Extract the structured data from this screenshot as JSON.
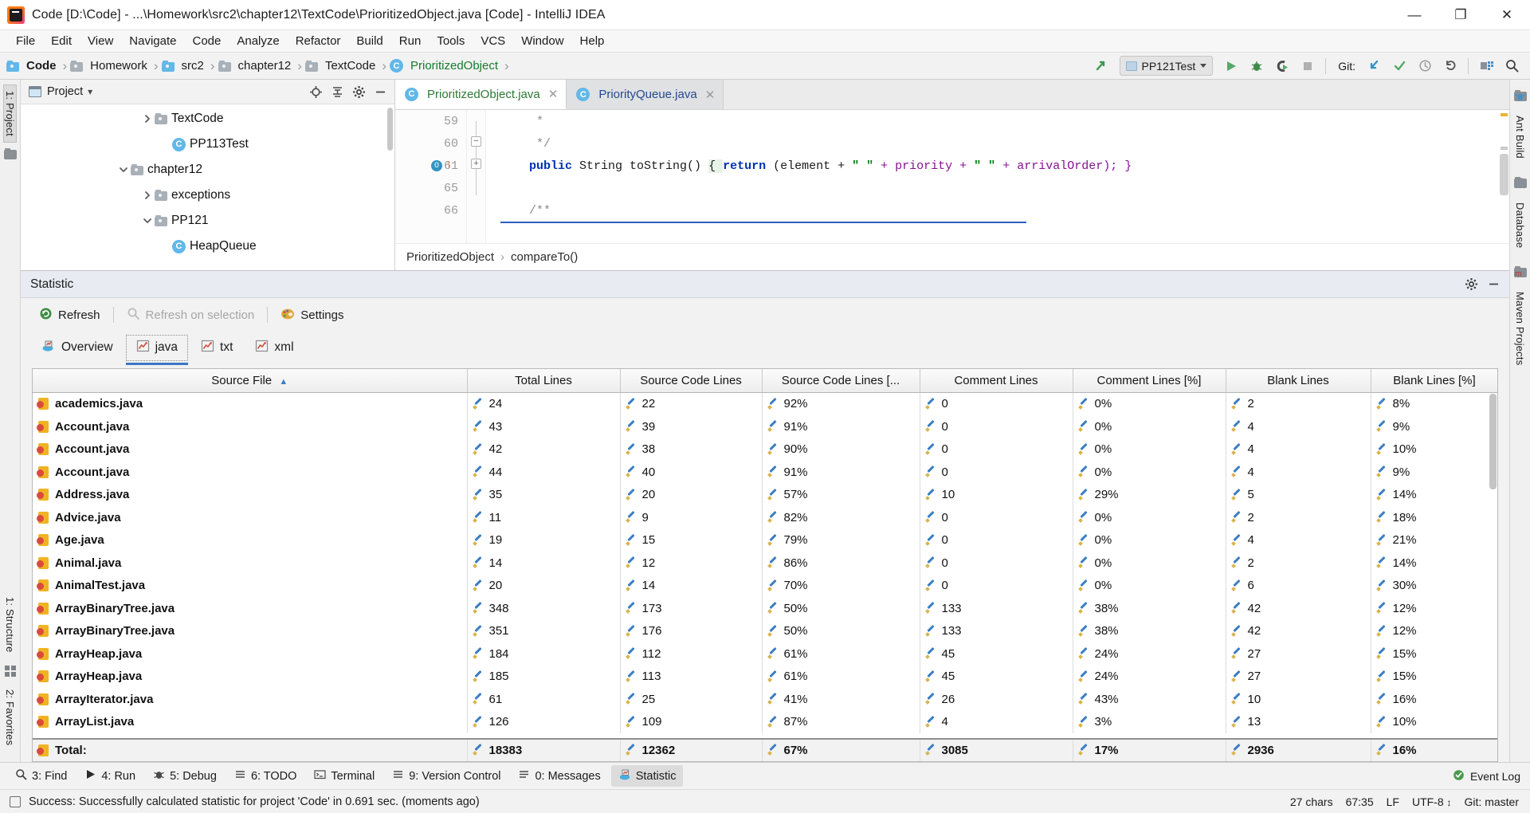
{
  "window": {
    "title": "Code [D:\\Code] - ...\\Homework\\src2\\chapter12\\TextCode\\PrioritizedObject.java [Code] - IntelliJ IDEA",
    "minimize": "—",
    "maximize": "❐",
    "close": "✕"
  },
  "menu": {
    "items": [
      "File",
      "Edit",
      "View",
      "Navigate",
      "Code",
      "Analyze",
      "Refactor",
      "Build",
      "Run",
      "Tools",
      "VCS",
      "Window",
      "Help"
    ]
  },
  "navbar": {
    "crumbs": [
      {
        "label": "Code",
        "icon": "module-folder-icon",
        "bold": true,
        "green": false
      },
      {
        "label": "Homework",
        "icon": "folder-icon",
        "bold": false,
        "green": false
      },
      {
        "label": "src2",
        "icon": "source-folder-icon",
        "bold": false,
        "green": false
      },
      {
        "label": "chapter12",
        "icon": "folder-icon",
        "bold": false,
        "green": false
      },
      {
        "label": "TextCode",
        "icon": "folder-icon",
        "bold": false,
        "green": false
      },
      {
        "label": "PrioritizedObject",
        "icon": "java-class-icon",
        "bold": false,
        "green": true
      }
    ],
    "separator": "›",
    "run_configuration": "PP121Test",
    "git_label": "Git:",
    "buttons": [
      "build-icon",
      "run-button",
      "debug-button",
      "run-coverage-button",
      "stop-button",
      "git-update-button",
      "git-commit-button",
      "git-history-button",
      "git-rollback-button",
      "project-structure-button",
      "search-everywhere-button"
    ]
  },
  "left_rail": {
    "items": [
      "1: Project",
      "1: Structure",
      "2: Favorites"
    ]
  },
  "right_rail": {
    "items": [
      "Ant Build",
      "Database",
      "Maven Projects"
    ]
  },
  "project_panel": {
    "title": "Project",
    "dropdown_caret": "▾",
    "actions": [
      "locate-icon",
      "collapse-all-icon",
      "settings-icon",
      "hide-icon"
    ],
    "tree": [
      {
        "label": "TextCode",
        "depth": 2,
        "icon": "folder-icon",
        "state": "collapsed"
      },
      {
        "label": "PP113Test",
        "depth": 3,
        "icon": "java-class-run-icon",
        "state": "leaf"
      },
      {
        "label": "chapter12",
        "depth": 1,
        "icon": "folder-icon",
        "state": "expanded"
      },
      {
        "label": "exceptions",
        "depth": 2,
        "icon": "folder-icon",
        "state": "collapsed"
      },
      {
        "label": "PP121",
        "depth": 2,
        "icon": "folder-icon",
        "state": "expanded"
      },
      {
        "label": "HeapQueue",
        "depth": 3,
        "icon": "java-class-icon",
        "state": "leaf"
      }
    ]
  },
  "editor": {
    "tabs": [
      {
        "label": "PrioritizedObject.java",
        "active": true,
        "icon": "java-class-icon",
        "close": "✕"
      },
      {
        "label": "PriorityQueue.java",
        "active": false,
        "icon": "java-class-icon",
        "close": "✕"
      }
    ],
    "lines": [
      {
        "number": "59",
        "fold": "",
        "marker": "",
        "segments": [
          {
            "t": "     *",
            "c": "cmt"
          }
        ]
      },
      {
        "number": "60",
        "fold": "minus",
        "marker": "",
        "segments": [
          {
            "t": "     */",
            "c": "cmt"
          }
        ]
      },
      {
        "number": "61",
        "fold": "plus",
        "marker": "override-implement",
        "segments": [
          {
            "t": "    ",
            "c": "ident"
          },
          {
            "t": "public",
            "c": "kw"
          },
          {
            "t": " String toString() ",
            "c": "ident"
          },
          {
            "t": "{ ",
            "c": "ident"
          },
          {
            "t": "return",
            "c": "kw"
          },
          {
            "t": " (element + ",
            "c": "ident"
          },
          {
            "t": "\" \"",
            "c": "str"
          },
          {
            "t": " + priority + ",
            "c": "ident"
          },
          {
            "t": "\" \"",
            "c": "str"
          },
          {
            "t": " + arrivalOrder); }",
            "c": "ident"
          }
        ]
      },
      {
        "number": "65",
        "fold": "",
        "marker": "",
        "segments": [
          {
            "t": "",
            "c": "ident"
          }
        ]
      },
      {
        "number": "66",
        "fold": "",
        "marker": "",
        "segments": [
          {
            "t": "    /**",
            "c": "cmt"
          }
        ]
      }
    ],
    "breadcrumb": [
      "PrioritizedObject",
      "compareTo()"
    ],
    "breadcrumb_sep": "›"
  },
  "statistic": {
    "title": "Statistic",
    "header_actions": [
      "gear-icon",
      "hide-icon"
    ],
    "toolbar": [
      {
        "label": "Refresh",
        "icon": "refresh-icon",
        "disabled": false
      },
      {
        "label": "Refresh on selection",
        "icon": "refresh-selection-icon",
        "disabled": true
      },
      {
        "label": "Settings",
        "icon": "settings-palette-icon",
        "disabled": false
      }
    ],
    "tabs": [
      {
        "label": "Overview",
        "icon": "overview-icon",
        "selected": false
      },
      {
        "label": "java",
        "icon": "chart-icon",
        "selected": true
      },
      {
        "label": "txt",
        "icon": "chart-icon",
        "selected": false
      },
      {
        "label": "xml",
        "icon": "chart-icon",
        "selected": false
      }
    ],
    "table": {
      "columns": [
        {
          "label": "Source File",
          "sort": "▲"
        },
        {
          "label": "Total Lines",
          "sort": ""
        },
        {
          "label": "Source Code Lines",
          "sort": ""
        },
        {
          "label": "Source Code Lines [...",
          "sort": ""
        },
        {
          "label": "Comment Lines",
          "sort": ""
        },
        {
          "label": "Comment Lines [%]",
          "sort": ""
        },
        {
          "label": "Blank Lines",
          "sort": ""
        },
        {
          "label": "Blank Lines [%]",
          "sort": ""
        }
      ],
      "rows": [
        {
          "file": "academics.java",
          "total": "24",
          "src": "22",
          "srcpct": "92%",
          "comment": "0",
          "commentpct": "0%",
          "blank": "2",
          "blankpct": "8%"
        },
        {
          "file": "Account.java",
          "total": "43",
          "src": "39",
          "srcpct": "91%",
          "comment": "0",
          "commentpct": "0%",
          "blank": "4",
          "blankpct": "9%"
        },
        {
          "file": "Account.java",
          "total": "42",
          "src": "38",
          "srcpct": "90%",
          "comment": "0",
          "commentpct": "0%",
          "blank": "4",
          "blankpct": "10%"
        },
        {
          "file": "Account.java",
          "total": "44",
          "src": "40",
          "srcpct": "91%",
          "comment": "0",
          "commentpct": "0%",
          "blank": "4",
          "blankpct": "9%"
        },
        {
          "file": "Address.java",
          "total": "35",
          "src": "20",
          "srcpct": "57%",
          "comment": "10",
          "commentpct": "29%",
          "blank": "5",
          "blankpct": "14%"
        },
        {
          "file": "Advice.java",
          "total": "11",
          "src": "9",
          "srcpct": "82%",
          "comment": "0",
          "commentpct": "0%",
          "blank": "2",
          "blankpct": "18%"
        },
        {
          "file": "Age.java",
          "total": "19",
          "src": "15",
          "srcpct": "79%",
          "comment": "0",
          "commentpct": "0%",
          "blank": "4",
          "blankpct": "21%"
        },
        {
          "file": "Animal.java",
          "total": "14",
          "src": "12",
          "srcpct": "86%",
          "comment": "0",
          "commentpct": "0%",
          "blank": "2",
          "blankpct": "14%"
        },
        {
          "file": "AnimalTest.java",
          "total": "20",
          "src": "14",
          "srcpct": "70%",
          "comment": "0",
          "commentpct": "0%",
          "blank": "6",
          "blankpct": "30%"
        },
        {
          "file": "ArrayBinaryTree.java",
          "total": "348",
          "src": "173",
          "srcpct": "50%",
          "comment": "133",
          "commentpct": "38%",
          "blank": "42",
          "blankpct": "12%"
        },
        {
          "file": "ArrayBinaryTree.java",
          "total": "351",
          "src": "176",
          "srcpct": "50%",
          "comment": "133",
          "commentpct": "38%",
          "blank": "42",
          "blankpct": "12%"
        },
        {
          "file": "ArrayHeap.java",
          "total": "184",
          "src": "112",
          "srcpct": "61%",
          "comment": "45",
          "commentpct": "24%",
          "blank": "27",
          "blankpct": "15%"
        },
        {
          "file": "ArrayHeap.java",
          "total": "185",
          "src": "113",
          "srcpct": "61%",
          "comment": "45",
          "commentpct": "24%",
          "blank": "27",
          "blankpct": "15%"
        },
        {
          "file": "ArrayIterator.java",
          "total": "61",
          "src": "25",
          "srcpct": "41%",
          "comment": "26",
          "commentpct": "43%",
          "blank": "10",
          "blankpct": "16%"
        },
        {
          "file": "ArrayList.java",
          "total": "126",
          "src": "109",
          "srcpct": "87%",
          "comment": "4",
          "commentpct": "3%",
          "blank": "13",
          "blankpct": "10%"
        }
      ],
      "total_row": {
        "file": "Total:",
        "total": "18383",
        "src": "12362",
        "srcpct": "67%",
        "comment": "3085",
        "commentpct": "17%",
        "blank": "2936",
        "blankpct": "16%"
      }
    }
  },
  "bottom_bar": {
    "items": [
      {
        "label": "3: Find",
        "icon": "find-icon",
        "active": false
      },
      {
        "label": "4: Run",
        "icon": "run-icon",
        "active": false
      },
      {
        "label": "5: Debug",
        "icon": "debug-icon",
        "active": false
      },
      {
        "label": "6: TODO",
        "icon": "todo-icon",
        "active": false
      },
      {
        "label": "Terminal",
        "icon": "terminal-icon",
        "active": false
      },
      {
        "label": "9: Version Control",
        "icon": "version-control-icon",
        "active": false
      },
      {
        "label": "0: Messages",
        "icon": "messages-icon",
        "active": false
      },
      {
        "label": "Statistic",
        "icon": "statistic-icon",
        "active": true
      }
    ],
    "event_log": "Event Log"
  },
  "status_bar": {
    "message": "Success: Successfully calculated statistic for project 'Code' in 0.691 sec. (moments ago)",
    "chars": "27 chars",
    "position": "67:35",
    "line_sep": "LF",
    "encoding": "UTF-8",
    "branch": "Git: master"
  }
}
